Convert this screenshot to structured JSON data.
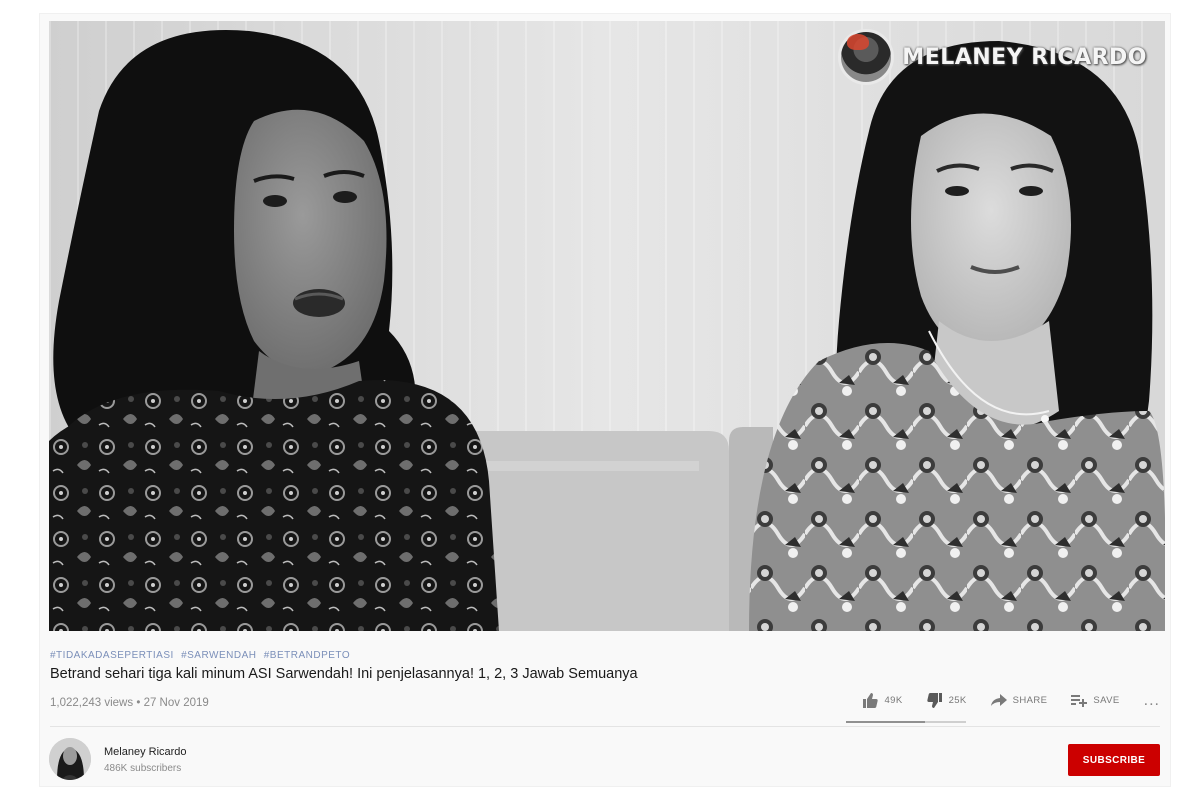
{
  "video": {
    "watermark_text": "MELANEY RICARDO",
    "hashtags": [
      "#TIDAKADASEPERTIASI",
      "#SARWENDAH",
      "#BETRANDPETO"
    ],
    "title": "Betrand sehari tiga kali minum ASI Sarwendah! Ini penjelasannya! 1, 2, 3 Jawab Semuanya",
    "views": "1,022,243 views",
    "separator": "•",
    "date": "27 Nov 2019",
    "like_ratio": 0.66
  },
  "actions": {
    "like_count": "49K",
    "dislike_count": "25K",
    "share_label": "SHARE",
    "save_label": "SAVE",
    "more_label": "..."
  },
  "channel": {
    "name": "Melaney Ricardo",
    "subscribers": "486K subscribers",
    "subscribe_label": "SUBSCRIBE"
  },
  "icons": {
    "like": "thumbs-up-icon",
    "dislike": "thumbs-down-icon",
    "share": "share-arrow-icon",
    "save": "playlist-add-icon",
    "more": "more-horizontal-icon"
  },
  "colors": {
    "subscribe": "#cc0000",
    "hashtag": "#7b8fb9"
  }
}
